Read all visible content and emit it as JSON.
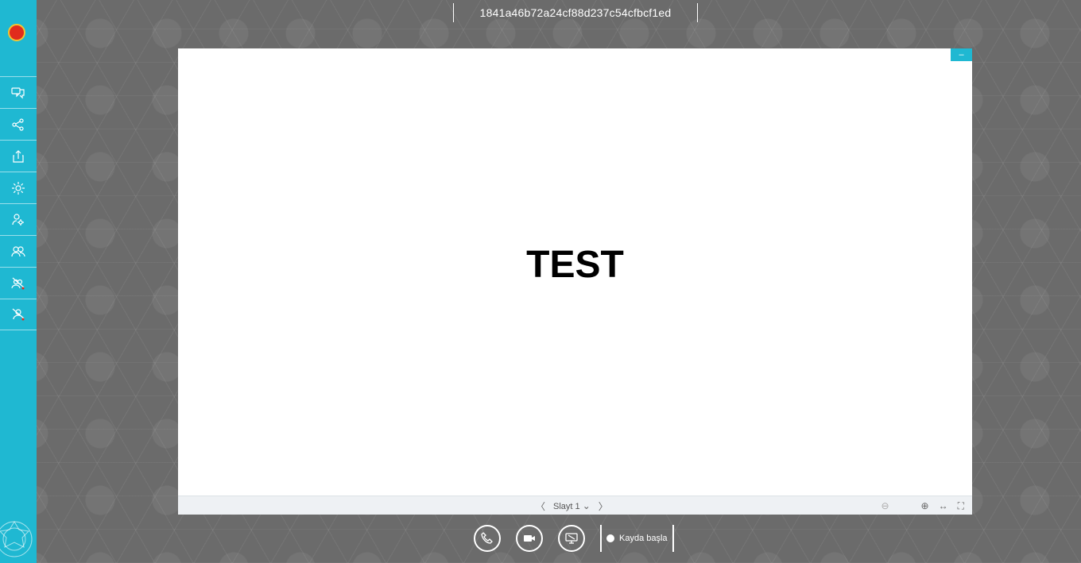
{
  "header": {
    "title": "1841a46b72a24cf88d237c54cfbcf1ed"
  },
  "sidebar": {
    "items": [
      {
        "name": "chat-icon"
      },
      {
        "name": "share-icon"
      },
      {
        "name": "upload-icon"
      },
      {
        "name": "settings-icon"
      },
      {
        "name": "user-settings-icon"
      },
      {
        "name": "users-icon"
      },
      {
        "name": "muted-users-icon"
      },
      {
        "name": "muted-user-icon"
      }
    ]
  },
  "slide": {
    "text": "TEST",
    "minimize_label": "–",
    "toolbar": {
      "prev": "〈",
      "slide_label": "Slayt 1",
      "dropdown": "⌄",
      "next": "〉",
      "zoom_out": "⊖",
      "zoom_in": "⊕",
      "fit_width": "↔",
      "fullscreen": "⛶"
    }
  },
  "controls": {
    "record_label": "Kayda başla"
  },
  "colors": {
    "accent": "#1fb8d2",
    "logo_red": "#e12c1d",
    "logo_gold": "#f4c430"
  }
}
